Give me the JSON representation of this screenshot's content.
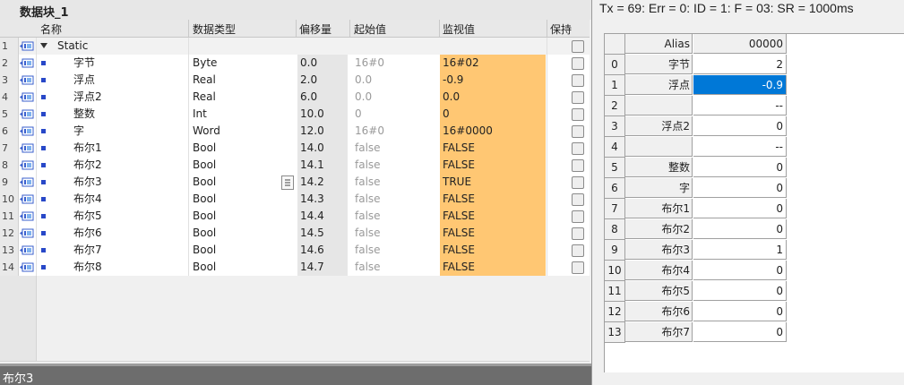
{
  "block_title": "数据块_1",
  "headers": {
    "name": "名称",
    "type": "数据类型",
    "offset": "偏移量",
    "start": "起始值",
    "monitor": "监视值",
    "retain": "保持"
  },
  "rows": [
    {
      "num": "1",
      "name": "Static",
      "type": "",
      "offset": "",
      "start": "",
      "monitor": ""
    },
    {
      "num": "2",
      "name": "字节",
      "type": "Byte",
      "offset": "0.0",
      "start": "16#0",
      "monitor": "16#02"
    },
    {
      "num": "3",
      "name": "浮点",
      "type": "Real",
      "offset": "2.0",
      "start": "0.0",
      "monitor": "-0.9"
    },
    {
      "num": "4",
      "name": "浮点2",
      "type": "Real",
      "offset": "6.0",
      "start": "0.0",
      "monitor": "0.0"
    },
    {
      "num": "5",
      "name": "整数",
      "type": "Int",
      "offset": "10.0",
      "start": "0",
      "monitor": "0"
    },
    {
      "num": "6",
      "name": "字",
      "type": "Word",
      "offset": "12.0",
      "start": "16#0",
      "monitor": "16#0000"
    },
    {
      "num": "7",
      "name": "布尔1",
      "type": "Bool",
      "offset": "14.0",
      "start": "false",
      "monitor": "FALSE"
    },
    {
      "num": "8",
      "name": "布尔2",
      "type": "Bool",
      "offset": "14.1",
      "start": "false",
      "monitor": "FALSE"
    },
    {
      "num": "9",
      "name": "布尔3",
      "type": "Bool",
      "offset": "14.2",
      "start": "false",
      "monitor": "TRUE"
    },
    {
      "num": "10",
      "name": "布尔4",
      "type": "Bool",
      "offset": "14.3",
      "start": "false",
      "monitor": "FALSE"
    },
    {
      "num": "11",
      "name": "布尔5",
      "type": "Bool",
      "offset": "14.4",
      "start": "false",
      "monitor": "FALSE"
    },
    {
      "num": "12",
      "name": "布尔6",
      "type": "Bool",
      "offset": "14.5",
      "start": "false",
      "monitor": "FALSE"
    },
    {
      "num": "13",
      "name": "布尔7",
      "type": "Bool",
      "offset": "14.6",
      "start": "false",
      "monitor": "FALSE"
    },
    {
      "num": "14",
      "name": "布尔8",
      "type": "Bool",
      "offset": "14.7",
      "start": "false",
      "monitor": "FALSE"
    }
  ],
  "status_bar": "布尔3",
  "monitor": {
    "status_line": "Tx = 69: Err = 0: ID = 1: F = 03: SR = 1000ms",
    "header_alias": "Alias",
    "header_value": "00000",
    "rows": [
      {
        "idx": "0",
        "alias": "字节",
        "value": "2"
      },
      {
        "idx": "1",
        "alias": "浮点",
        "value": "-0.9"
      },
      {
        "idx": "2",
        "alias": "",
        "value": "--"
      },
      {
        "idx": "3",
        "alias": "浮点2",
        "value": "0"
      },
      {
        "idx": "4",
        "alias": "",
        "value": "--"
      },
      {
        "idx": "5",
        "alias": "整数",
        "value": "0"
      },
      {
        "idx": "6",
        "alias": "字",
        "value": "0"
      },
      {
        "idx": "7",
        "alias": "布尔1",
        "value": "0"
      },
      {
        "idx": "8",
        "alias": "布尔2",
        "value": "0"
      },
      {
        "idx": "9",
        "alias": "布尔3",
        "value": "1"
      },
      {
        "idx": "10",
        "alias": "布尔4",
        "value": "0"
      },
      {
        "idx": "11",
        "alias": "布尔5",
        "value": "0"
      },
      {
        "idx": "12",
        "alias": "布尔6",
        "value": "0"
      },
      {
        "idx": "13",
        "alias": "布尔7",
        "value": "0"
      }
    ]
  }
}
